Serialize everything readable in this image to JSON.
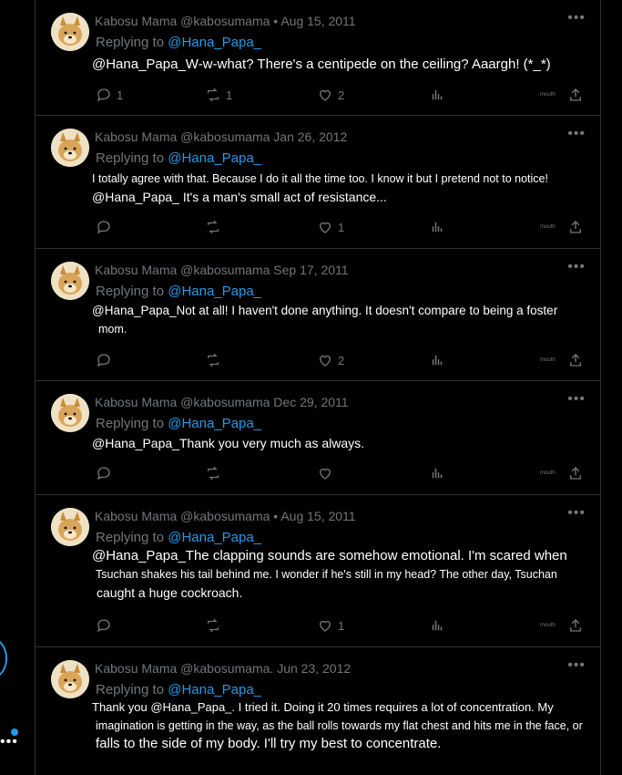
{
  "tweets": [
    {
      "author": "Kabosu Mama @kabosumama • Aug 15, 2011",
      "replying_label": "Replying to",
      "replying_handle": "@Hana_Papa_",
      "lines": [
        "@Hana_Papa_W-w-what? There's a centipede on the ceiling? Aaargh! (*_*)"
      ],
      "replies": "1",
      "retweets": "1",
      "likes": "2",
      "extra": "mouth"
    },
    {
      "author": "Kabosu Mama @kabosumama Jan 26, 2012",
      "replying_label": "Replying to",
      "replying_handle": "@Hana_Papa_",
      "lines": [
        "I totally agree with that. Because I do it all the time too. I know it but I pretend not to notice!",
        "@Hana_Papa_ It's a man's small act of resistance..."
      ],
      "replies": "",
      "retweets": "",
      "likes": "1",
      "extra": "mouth"
    },
    {
      "author": "Kabosu Mama @kabosumama Sep 17, 2011",
      "replying_label": "Replying to",
      "replying_handle": "@Hana_Papa_",
      "lines": [
        "@Hana_Papa_Not at all! I haven't done anything. It doesn't compare to being a foster",
        "mom."
      ],
      "replies": "",
      "retweets": "",
      "likes": "2",
      "extra": "mouth"
    },
    {
      "author": "Kabosu Mama @kabosumama Dec 29, 2011",
      "replying_label": "Replying to",
      "replying_handle": "@Hana_Papa_",
      "lines": [
        "@Hana_Papa_Thank you very much as always."
      ],
      "replies": "",
      "retweets": "",
      "likes": "",
      "extra": "mouth"
    },
    {
      "author": "Kabosu Mama @kabosumama • Aug 15, 2011",
      "replying_label": "Replying to",
      "replying_handle": "@Hana_Papa_",
      "lines": [
        "@Hana_Papa_The clapping sounds are somehow emotional. I'm scared when",
        "Tsuchan shakes his tail behind me. I wonder if he's still in my head? The other day, Tsuchan",
        "caught a huge cockroach."
      ],
      "replies": "",
      "retweets": "",
      "likes": "1",
      "extra": "mouth"
    },
    {
      "author": "Kabosu Mama @kabosumama. Jun 23, 2012",
      "replying_label": "Replying to",
      "replying_handle": "@Hana_Papa_",
      "lines": [
        "Thank you @Hana_Papa_. I tried it. Doing it 20 times requires a lot of concentration. My",
        "imagination is getting in the way, as the ball rolls towards my flat chest and hits me in the face, or",
        "falls to the side of my body. I'll try my best to concentrate."
      ]
    }
  ]
}
